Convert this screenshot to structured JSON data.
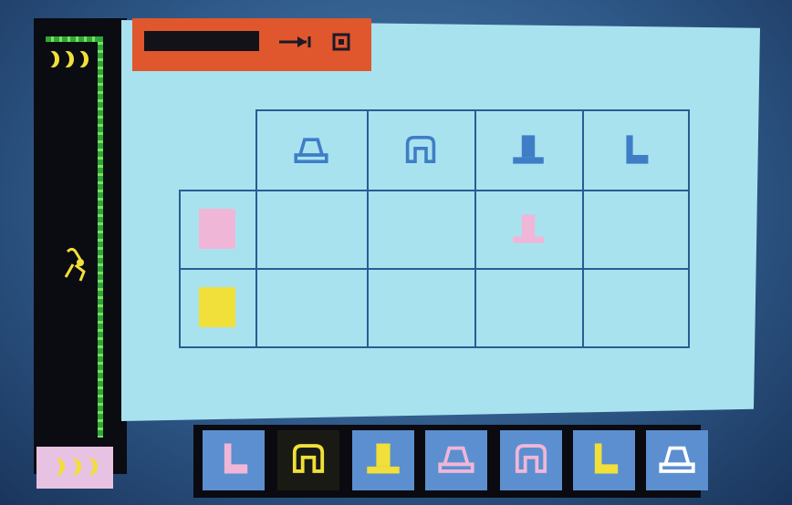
{
  "colors": {
    "play_background": "#a9e2ef",
    "status_bar": "#e0562d",
    "grid_lines": "#2a5c93",
    "outline_shape": "#3f7ec6",
    "pink": "#f0b6d8",
    "yellow": "#f1df3a",
    "tile": "#5c8fcf",
    "lives_panel": "#e8c2e2",
    "vine": "#2ea83a"
  },
  "status_bar": {
    "icons": [
      "progress-bar-icon",
      "arrow-to-line-icon",
      "stop-square-icon"
    ]
  },
  "grid": {
    "column_headers": [
      {
        "shape": "trapezoid-hat",
        "color": "#3f7ec6"
      },
      {
        "shape": "arch",
        "color": "#3f7ec6"
      },
      {
        "shape": "top-hat",
        "color": "#3f7ec6"
      },
      {
        "shape": "boot-l",
        "color": "#3f7ec6"
      }
    ],
    "row_headers": [
      {
        "swatch_color": "#f0b6d8"
      },
      {
        "swatch_color": "#f1df3a"
      }
    ],
    "filled_cells": [
      {
        "row": 0,
        "col": 2,
        "shape": "top-hat",
        "color": "#f0b6d8"
      }
    ]
  },
  "tray": {
    "tiles": [
      {
        "shape": "boot-l",
        "color": "#f0b6d8",
        "selected": false
      },
      {
        "shape": "arch",
        "color": "#f1df3a",
        "selected": true
      },
      {
        "shape": "top-hat",
        "color": "#f1df3a",
        "selected": false
      },
      {
        "shape": "trapezoid-hat",
        "color": "#f0b6d8",
        "selected": false
      },
      {
        "shape": "arch",
        "color": "#f0b6d8",
        "selected": false
      },
      {
        "shape": "boot-l",
        "color": "#f1df3a",
        "selected": false
      },
      {
        "shape": "trapezoid-hat",
        "color": "#ffffff",
        "selected": false
      }
    ]
  },
  "lives": {
    "count": 3,
    "icon": "crescent-moon-icon"
  },
  "top_moons": {
    "count": 3,
    "icon": "crescent-moon-icon"
  }
}
